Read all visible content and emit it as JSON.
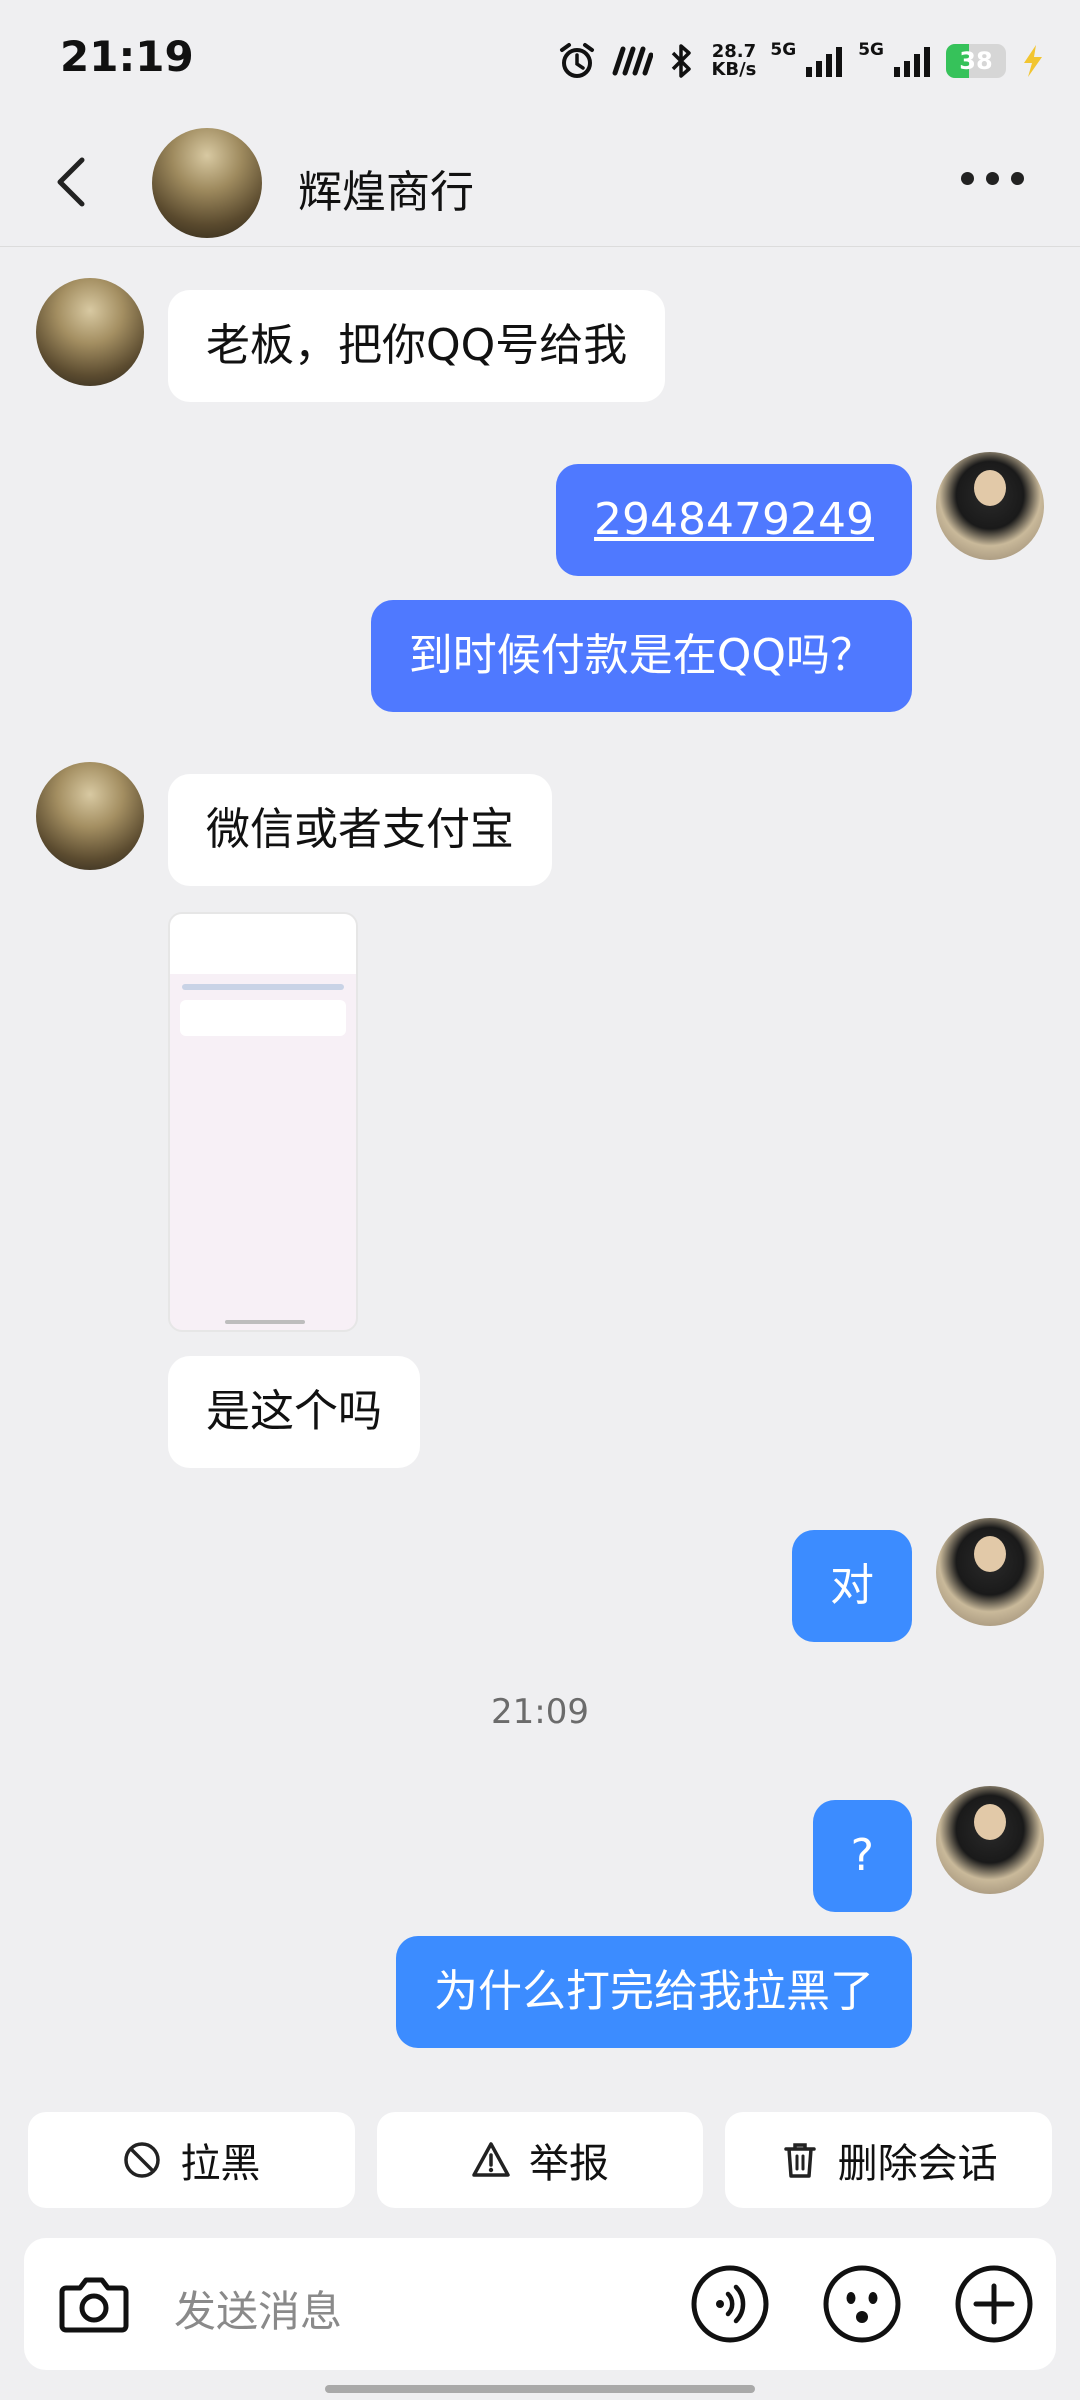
{
  "status_bar": {
    "time": "21:19",
    "net_speed": "28.7",
    "net_unit": "KB/s",
    "sim1": "5G",
    "sim2": "5G",
    "battery": "38",
    "battery_level": 0.38,
    "colors": {
      "battery_fill": "#36c25a"
    }
  },
  "header": {
    "title": "辉煌商行",
    "icons": {
      "back": "back-arrow-icon",
      "more": "more-dots-icon"
    }
  },
  "messages": [
    {
      "side": "in",
      "text": "老板，把你QQ号给我"
    },
    {
      "side": "out",
      "text": "2948479249",
      "style": "link"
    },
    {
      "side": "out",
      "text": "到时候付款是在QQ吗？"
    },
    {
      "side": "in",
      "text": "微信或者支付宝"
    },
    {
      "side": "in",
      "type": "image"
    },
    {
      "side": "in",
      "text": "是这个吗"
    },
    {
      "side": "out",
      "text": "对"
    },
    {
      "side": "out",
      "text": "?"
    },
    {
      "side": "out",
      "text": "为什么打完给我拉黑了"
    }
  ],
  "timestamp": "21:09",
  "actions": [
    {
      "label": "拉黑",
      "icon": "block-icon"
    },
    {
      "label": "举报",
      "icon": "warning-icon"
    },
    {
      "label": "删除会话",
      "icon": "trash-icon"
    }
  ],
  "input": {
    "placeholder": "发送消息",
    "icons": {
      "camera": "camera-icon",
      "voice": "voice-icon",
      "emoji": "emoji-icon",
      "plus": "plus-icon"
    }
  },
  "colors": {
    "bubble_out_primary": "#4f79ff",
    "bubble_out_secondary": "#3c8cff",
    "bubble_in": "#ffffff",
    "background": "#efeff1"
  }
}
